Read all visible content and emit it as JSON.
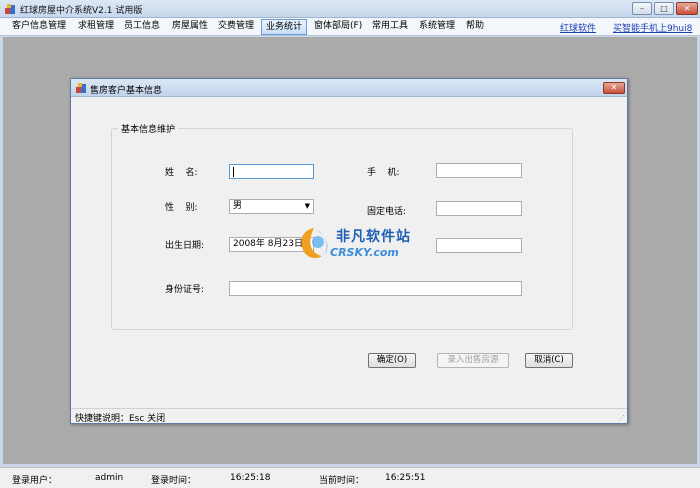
{
  "app": {
    "title": "红球房屋中介系统V2.1 试用版"
  },
  "window_controls": {
    "minimize": "–",
    "maximize": "□",
    "close": "✕"
  },
  "menu": {
    "items": [
      "客户信息管理",
      "求租管理",
      "员工信息",
      "房屋属性",
      "交费管理",
      "业务统计",
      "窗体部局(F)",
      "常用工具",
      "系统管理",
      "帮助"
    ],
    "active_index": 5,
    "links": [
      "红球软件",
      "买智能手机上9hui8"
    ]
  },
  "dialog": {
    "title": "售房客户基本信息",
    "close": "✕",
    "group_title": "基本信息维护",
    "fields": {
      "name_label": "姓    名:",
      "name_value": "",
      "mobile_label": "手    机:",
      "mobile_value": "",
      "gender_label": "性    别:",
      "gender_value": "男",
      "phone_label": "固定电话:",
      "phone_value": "",
      "birth_label": "出生日期:",
      "birth_value": "2008年  8月23日",
      "extra_value": "",
      "id_label": "身份证号:",
      "id_value": ""
    },
    "buttons": {
      "ok": "确定(O)",
      "register": "录入出售房源",
      "cancel": "取消(C)"
    },
    "status": "快捷键说明：Esc 关闭",
    "grip": "⋰"
  },
  "watermark": {
    "title": "非凡软件站",
    "sub": "CRSKY.com"
  },
  "statusbar": {
    "user_label": "登录用户：",
    "user_value": "admin",
    "login_label": "登录时间：",
    "login_value": "16:25:18",
    "now_label": "当前时间：",
    "now_value": "16:25:51"
  },
  "colors": {
    "active_menu": "#c7def7",
    "link": "#1a3fb3",
    "workspace": "#aaaaaa"
  }
}
